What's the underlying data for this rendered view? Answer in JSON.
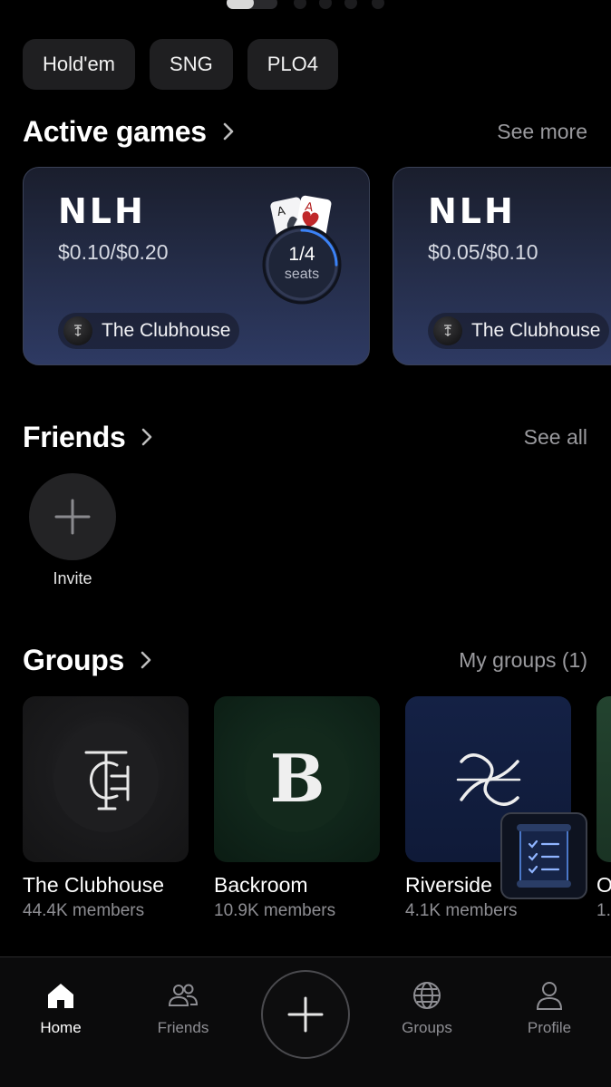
{
  "filters": [
    "Hold'em",
    "SNG",
    "PLO4"
  ],
  "active_games": {
    "title": "Active games",
    "see_more": "See more",
    "cards": [
      {
        "game": "NLH",
        "stakes": "$0.10/$0.20",
        "seats": "1/4",
        "seats_label": "seats",
        "seats_filled_fraction": 0.25,
        "club": "The Clubhouse"
      },
      {
        "game": "NLH",
        "stakes": "$0.05/$0.10",
        "club": "The Clubhouse"
      }
    ]
  },
  "friends": {
    "title": "Friends",
    "see_all": "See all",
    "invite_label": "Invite"
  },
  "groups": {
    "title": "Groups",
    "my_groups": "My groups (1)",
    "items": [
      {
        "name": "The Clubhouse",
        "members": "44.4K members"
      },
      {
        "name": "Backroom",
        "members": "10.9K members"
      },
      {
        "name": "Riverside",
        "members": "4.1K members"
      },
      {
        "name": "O",
        "members": "1."
      }
    ]
  },
  "tabbar": {
    "home": "Home",
    "friends": "Friends",
    "groups": "Groups",
    "profile": "Profile",
    "active": "Home"
  },
  "colors": {
    "background": "#000000",
    "card_gradient_top": "#1a1e2d",
    "card_gradient_bottom": "#2e3a63",
    "seat_ring_accent": "#3b82f6",
    "muted_text": "#8e8e93"
  }
}
